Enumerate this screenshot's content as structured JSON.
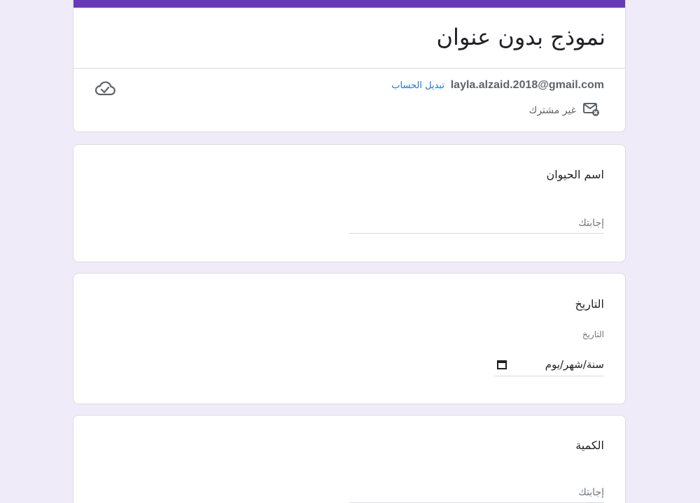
{
  "form": {
    "title": "نموذج بدون عنوان",
    "accent_color": "#673ab7",
    "background_color": "#f0ebf8"
  },
  "account": {
    "email": "layla.alzaid.2018@gmail.com",
    "switch_label": "تبديل الحساب",
    "not_shared_label": "غير مشترك",
    "status_icon": "cloud-check-icon",
    "not_shared_icon": "mail-x-icon"
  },
  "questions": [
    {
      "title": "اسم الحيوان",
      "placeholder": "إجابتك"
    },
    {
      "title": "التاريخ",
      "sublabel": "التاريخ",
      "date_placeholder": "سنة/شهر/يوم",
      "icon": "calendar-icon"
    },
    {
      "title": "الكمية",
      "placeholder": "إجابتك"
    }
  ]
}
